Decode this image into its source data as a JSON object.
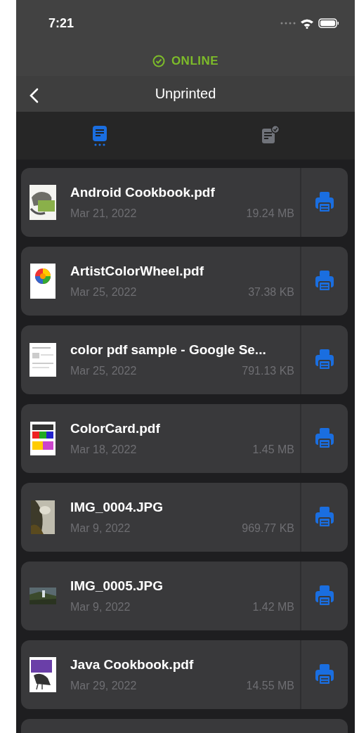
{
  "status_bar": {
    "time": "7:21"
  },
  "connection": {
    "label": "ONLINE"
  },
  "nav": {
    "title": "Unprinted"
  },
  "tabs": [
    {
      "kind": "unprinted",
      "selected": true
    },
    {
      "kind": "printed",
      "selected": false
    }
  ],
  "files": [
    {
      "name": "Android Cookbook.pdf",
      "date": "Mar 21, 2022",
      "size": "19.24 MB"
    },
    {
      "name": "ArtistColorWheel.pdf",
      "date": "Mar 25, 2022",
      "size": "37.38 KB"
    },
    {
      "name": "color pdf sample - Google Se...",
      "date": "Mar 25, 2022",
      "size": "791.13 KB"
    },
    {
      "name": "ColorCard.pdf",
      "date": "Mar 18, 2022",
      "size": "1.45 MB"
    },
    {
      "name": "IMG_0004.JPG",
      "date": "Mar 9, 2022",
      "size": "969.77 KB"
    },
    {
      "name": "IMG_0005.JPG",
      "date": "Mar 9, 2022",
      "size": "1.42 MB"
    },
    {
      "name": "Java Cookbook.pdf",
      "date": "Mar 29, 2022",
      "size": "14.55 MB"
    }
  ]
}
